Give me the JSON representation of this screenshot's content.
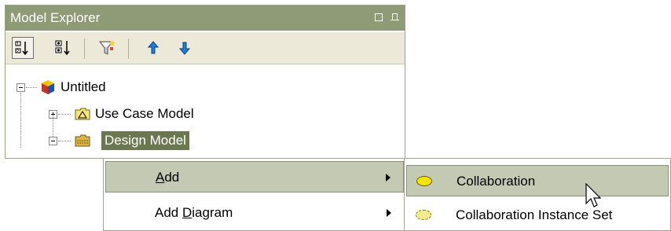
{
  "panel": {
    "title": "Model Explorer",
    "title_buttons": [
      "maximize-icon",
      "pin-icon"
    ]
  },
  "toolbar": {
    "buttons": [
      {
        "name": "sort-by-order-icon",
        "pressed": true
      },
      {
        "name": "sort-alphabetically-icon",
        "pressed": false
      },
      {
        "name": "filter-icon",
        "pressed": false
      },
      {
        "name": "move-up-arrow-icon",
        "pressed": false
      },
      {
        "name": "move-down-arrow-icon",
        "pressed": false
      }
    ]
  },
  "tree": {
    "root": {
      "label": "Untitled",
      "expanded": true,
      "icon": "project-cube-icon"
    },
    "children": [
      {
        "label": "Use Case Model",
        "expanded": false,
        "icon": "use-case-model-icon"
      },
      {
        "label": "Design Model",
        "expanded": true,
        "selected": true,
        "icon": "design-model-icon"
      }
    ]
  },
  "context_menu": {
    "items": [
      {
        "prefix": "",
        "accel": "A",
        "suffix": "dd",
        "highlighted": true,
        "has_submenu": true
      },
      {
        "prefix": "Add ",
        "accel": "D",
        "suffix": "iagram",
        "highlighted": false,
        "has_submenu": true
      }
    ]
  },
  "submenu": {
    "items": [
      {
        "label": "Collaboration",
        "highlighted": true,
        "icon": "collaboration-ellipse-icon",
        "icon_color": "#f5e400"
      },
      {
        "label": "Collaboration Instance Set",
        "highlighted": false,
        "icon": "collaboration-instance-set-icon",
        "icon_color": "#f2ec8c"
      }
    ]
  },
  "colors": {
    "titlebar": "#8f9a76",
    "selection": "#6b7750",
    "menu_highlight": "#c4c9b3",
    "toolbar_bg": "#ece9d8"
  }
}
